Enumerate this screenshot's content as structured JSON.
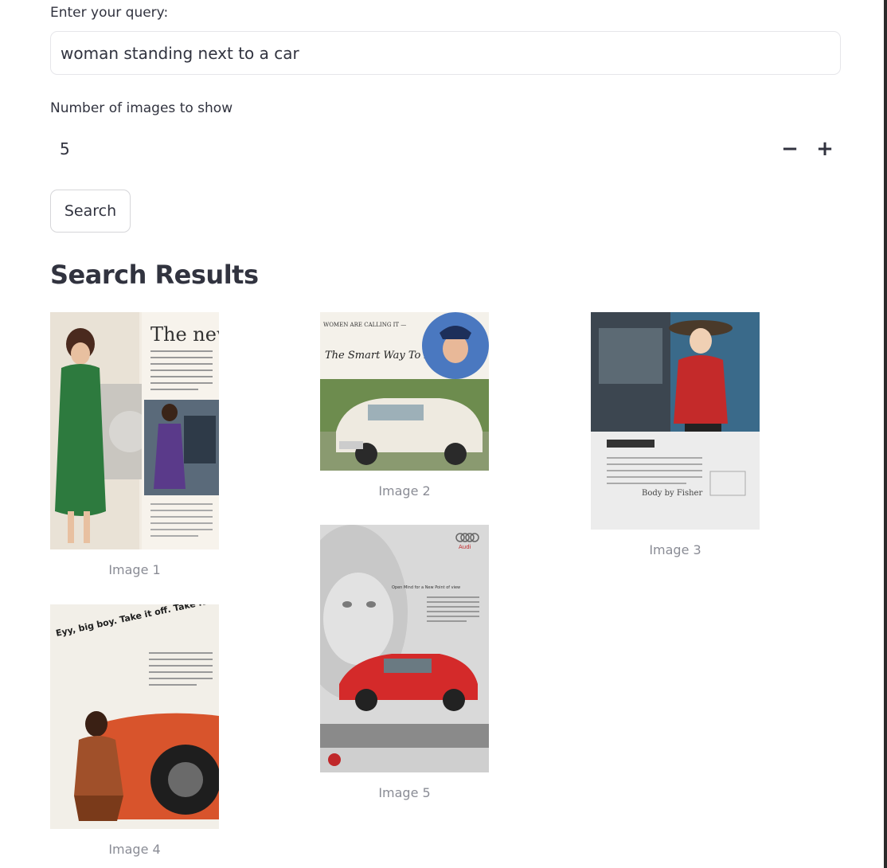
{
  "query": {
    "label": "Enter your query:",
    "value": "woman standing next to a car"
  },
  "num_images": {
    "label": "Number of images to show",
    "value": "5",
    "decrement": "−",
    "increment": "+"
  },
  "search_button": "Search",
  "results": {
    "heading": "Search Results",
    "images": [
      {
        "caption": "Image 1",
        "ad_text": "The new"
      },
      {
        "caption": "Image 2",
        "ad_text_top": "WOMEN ARE CALLING IT —",
        "ad_text_script": "The Smart Way To Drive"
      },
      {
        "caption": "Image 3",
        "ad_text": "Body by Fisher"
      },
      {
        "caption": "Image 4",
        "ad_text": "Eyy, big boy. Take it off. Take it all off. And change into Pirelli!"
      },
      {
        "caption": "Image 5",
        "ad_text": "Open Mind for a New Point of view",
        "brand": "Audi"
      }
    ]
  },
  "colors": {
    "text": "#31333f",
    "caption": "#8a8c95",
    "border": "#e6e6ea"
  }
}
